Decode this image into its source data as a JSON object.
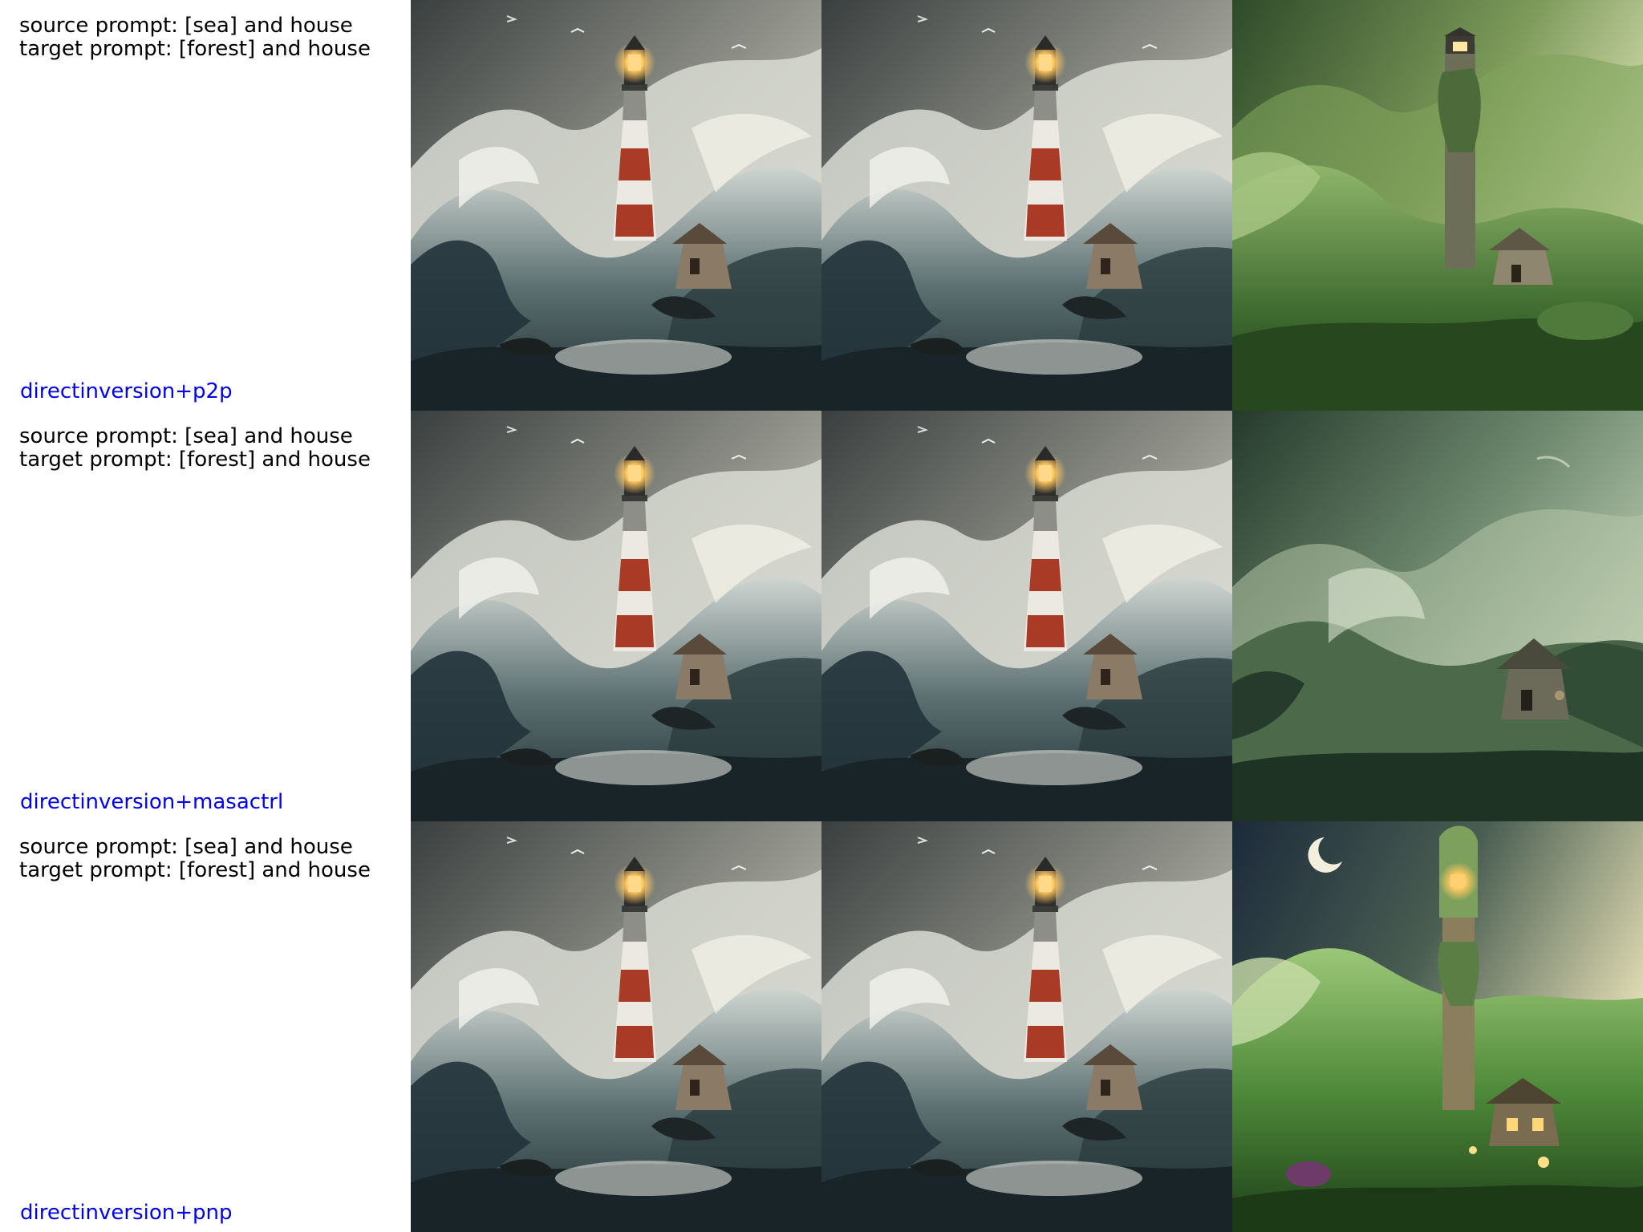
{
  "rows": [
    {
      "source_prompt": "source prompt: [sea] and house",
      "target_prompt": "target prompt: [forest] and house",
      "method": "directinversion+p2p",
      "images": [
        {
          "scene": "stormy sea with striped lighthouse and small stone house"
        },
        {
          "scene": "stormy sea with striped lighthouse and small stone house (reconstruction)"
        },
        {
          "scene": "green forest hillside with ivy-covered lighthouse tower and stone house"
        }
      ]
    },
    {
      "source_prompt": "source prompt: [sea] and house",
      "target_prompt": "target prompt: [forest] and house",
      "method": "directinversion+masactrl",
      "images": [
        {
          "scene": "stormy sea with striped lighthouse and small stone house"
        },
        {
          "scene": "stormy sea with striped lighthouse and small stone house (reconstruction)"
        },
        {
          "scene": "misty green waves with stone house, lighthouse mostly dissolved"
        }
      ]
    },
    {
      "source_prompt": "source prompt: [sea] and house",
      "target_prompt": "target prompt: [forest] and house",
      "method": "directinversion+pnp",
      "images": [
        {
          "scene": "stormy sea with striped lighthouse and small stone house"
        },
        {
          "scene": "stormy sea with striped lighthouse and small stone house (reconstruction)"
        },
        {
          "scene": "night forest hill with moss-covered tower, glowing windows and crescent moon"
        }
      ]
    }
  ],
  "colors": {
    "caption_text": "#000000",
    "method_text": "#0000ee",
    "background": "#ffffff"
  }
}
